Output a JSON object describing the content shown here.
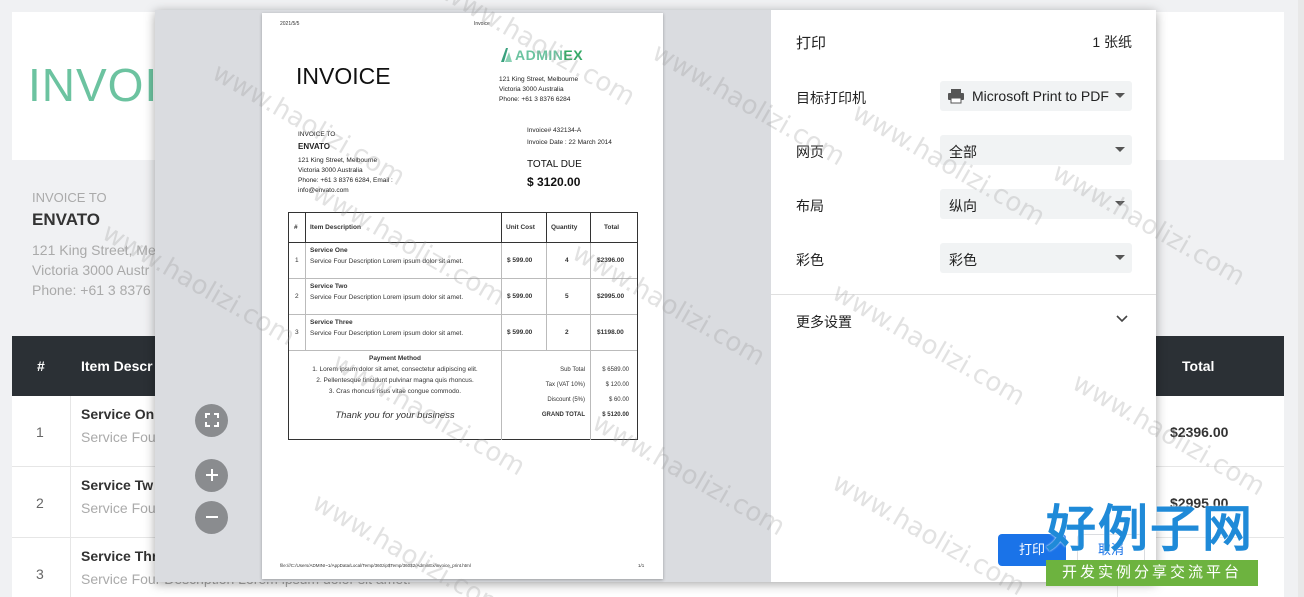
{
  "background": {
    "title": "INVOI",
    "invoice_to_label": "INVOICE TO",
    "company": "ENVATO",
    "address_lines": [
      "121 King Street, Me",
      "Victoria 3000 Austr",
      "Phone: +61 3 8376"
    ],
    "table_headers": {
      "num": "#",
      "desc": "Item Descr",
      "total": "Total"
    },
    "rows": [
      {
        "num": "1",
        "name": "Service On",
        "desc": "Service Fou",
        "total": "$2396.00"
      },
      {
        "num": "2",
        "name": "Service Tw",
        "desc": "Service Fou",
        "total": "$2995.00"
      },
      {
        "num": "3",
        "name": "Service Thr",
        "desc": "Service Four Description Lorem ipsum dolor sit amet.",
        "total": ""
      }
    ]
  },
  "preview": {
    "header_date": "2021/5/5",
    "header_title": "Invoice",
    "title": "INVOICE",
    "logo_a": "ADMIN",
    "logo_b": "EX",
    "company_address": [
      "121 King Street, Melbourne",
      "Victoria 3000 Australia",
      "Phone: +61 3 8376 6284"
    ],
    "invoice_to_label": "INVOICE TO",
    "client": "ENVATO",
    "client_address": [
      "121 King Street, Melbourne",
      "Victoria 3000 Australia",
      "Phone: +61 3 8376 6284, Email :",
      "info@envato.com"
    ],
    "invoice_no": "Invoice# 432134-A",
    "invoice_date": "Invoice Date : 22 March 2014",
    "total_due_label": "TOTAL DUE",
    "total_due": "$ 3120.00",
    "columns": {
      "num": "#",
      "desc": "Item Description",
      "unit": "Unit Cost",
      "qty": "Quantity",
      "total": "Total"
    },
    "items": [
      {
        "n": "1",
        "name": "Service One",
        "desc": "Service Four Description Lorem ipsum dolor sit amet.",
        "unit": "$ 599.00",
        "qty": "4",
        "total": "$2396.00"
      },
      {
        "n": "2",
        "name": "Service Two",
        "desc": "Service Four Description Lorem ipsum dolor sit amet.",
        "unit": "$ 599.00",
        "qty": "5",
        "total": "$2995.00"
      },
      {
        "n": "3",
        "name": "Service Three",
        "desc": "Service Four Description Lorem ipsum dolor sit amet.",
        "unit": "$ 599.00",
        "qty": "2",
        "total": "$1198.00"
      }
    ],
    "payment_heading": "Payment Method",
    "payment_lines": [
      "1. Lorem ipsum dolor sit amet, consectetur adipiscing elit.",
      "2. Pellentesque tincidunt pulvinar magna quis rhoncus.",
      "3. Cras rhoncus risus vitae congue commodo."
    ],
    "thanks": "Thank you for your business",
    "summary_labels": [
      "Sub Total",
      "Tax (VAT 10%)",
      "Discount (5%)",
      "GRAND TOTAL"
    ],
    "summary_values": [
      "$ 6589.00",
      "$ 120.00",
      "$ 60.00",
      "$ 5120.00"
    ],
    "footer_path": "file:///C:/Users/ADMINI~1/AppData/Local/Temp/360zip$Temp/360$2/AdminEx/invoice_print.html",
    "footer_page": "1/1"
  },
  "panel": {
    "title": "打印",
    "sheets": "1 张纸",
    "destination_label": "目标打印机",
    "destination_value": "Microsoft Print to PDF",
    "pages_label": "网页",
    "pages_value": "全部",
    "layout_label": "布局",
    "layout_value": "纵向",
    "color_label": "彩色",
    "color_value": "彩色",
    "more_settings": "更多设置",
    "print_button": "打印",
    "cancel_button": "取消"
  },
  "watermark": {
    "text": "www.haolizi.com",
    "brand_big": "好例子网",
    "brand_small": "开发实例分享交流平台"
  },
  "colors": {
    "accent": "#6cc3a0",
    "primary": "#1a73e8",
    "header_dark": "#2b3035"
  }
}
